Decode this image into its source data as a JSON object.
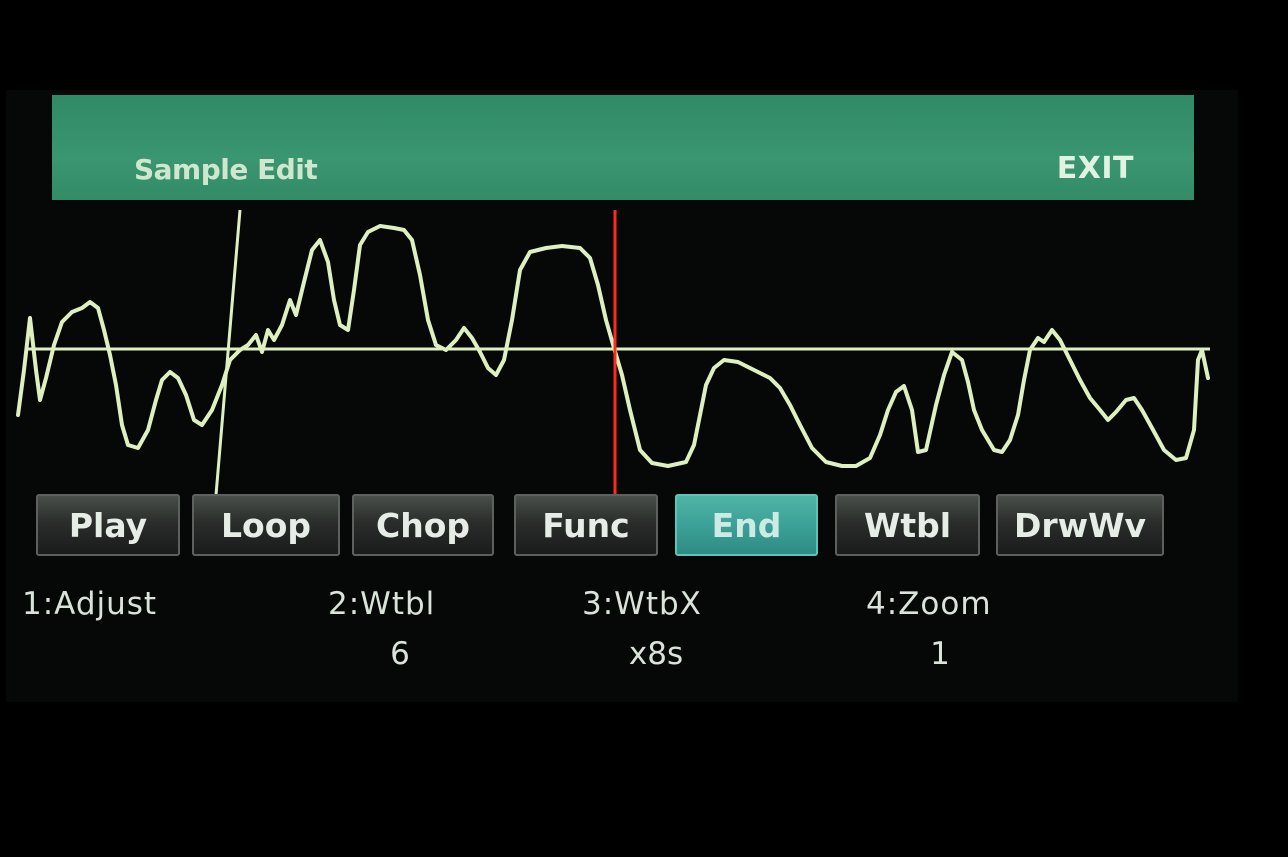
{
  "header": {
    "title": "Sample Edit",
    "exit_label": "EXIT"
  },
  "softkeys": [
    {
      "label": "Play",
      "active": false
    },
    {
      "label": "Loop",
      "active": false
    },
    {
      "label": "Chop",
      "active": false
    },
    {
      "label": "Func",
      "active": false
    },
    {
      "label": "End",
      "active": true
    },
    {
      "label": "Wtbl",
      "active": false
    },
    {
      "label": "DrwWv",
      "active": false
    }
  ],
  "params": [
    {
      "label": "1:Adjust",
      "value": ""
    },
    {
      "label": "2:Wtbl",
      "value": "6"
    },
    {
      "label": "3:WtbX",
      "value": "x8s"
    },
    {
      "label": "4:Zoom",
      "value": "1"
    }
  ],
  "colors": {
    "header_bg": "#3a9670",
    "waveform": "#dff0c0",
    "end_marker": "#ff2a1a",
    "active_key": "#3a9f95"
  }
}
